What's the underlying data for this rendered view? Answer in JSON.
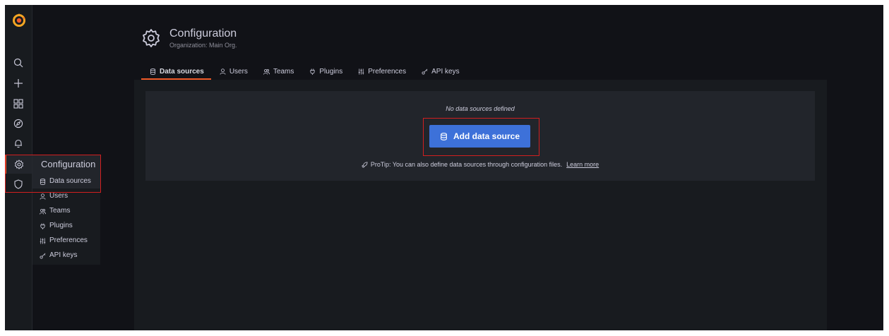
{
  "header": {
    "title": "Configuration",
    "subtitle": "Organization: Main Org."
  },
  "tabs": [
    {
      "label": "Data sources",
      "icon": "database-icon",
      "active": true
    },
    {
      "label": "Users",
      "icon": "user-icon",
      "active": false
    },
    {
      "label": "Teams",
      "icon": "users-icon",
      "active": false
    },
    {
      "label": "Plugins",
      "icon": "plug-icon",
      "active": false
    },
    {
      "label": "Preferences",
      "icon": "sliders-icon",
      "active": false
    },
    {
      "label": "API keys",
      "icon": "key-icon",
      "active": false
    }
  ],
  "sidebar": {
    "icons": [
      "grafana-logo",
      "search-icon",
      "plus-icon",
      "dashboards-icon",
      "explore-icon",
      "alert-bell-icon",
      "gear-icon",
      "shield-icon"
    ],
    "flyout": {
      "title": "Configuration",
      "items": [
        {
          "label": "Data sources",
          "icon": "database-icon"
        },
        {
          "label": "Users",
          "icon": "user-icon"
        },
        {
          "label": "Teams",
          "icon": "users-icon"
        },
        {
          "label": "Plugins",
          "icon": "plug-icon"
        },
        {
          "label": "Preferences",
          "icon": "sliders-icon"
        },
        {
          "label": "API keys",
          "icon": "key-icon"
        }
      ]
    }
  },
  "empty_state": {
    "title": "No data sources defined",
    "button_label": "Add data source",
    "protip_text": "ProTip: You can also define data sources through configuration files.",
    "learn_more": "Learn more"
  },
  "colors": {
    "accent": "#f05a28",
    "primary_button": "#3d71d9",
    "highlight": "#d21f1f",
    "background": "#111217",
    "panel": "#181b1f"
  }
}
